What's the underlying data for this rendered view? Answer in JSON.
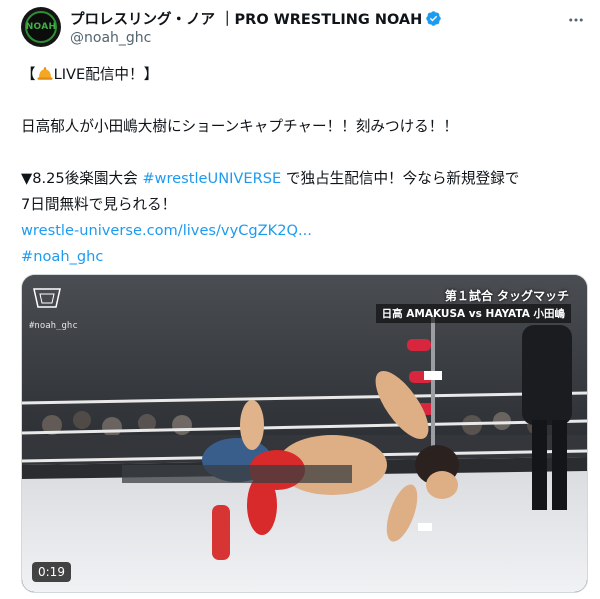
{
  "author": {
    "display_name": "プロレスリング・ノア ｜PRO WRESTLING NOAH",
    "handle": "@noah_ghc",
    "avatar_text": "NOAH"
  },
  "tweet": {
    "line1": "【 LIVE配信中！】",
    "line2": "日高郁人が小田嶋大樹にショーンキャプチャー！！刻みつける！！",
    "line3_pre": "▼8.25後楽園大会 ",
    "line3_hashtag": "#wrestleUNIVERSE",
    "line3_post": " で独占生配信中！今なら新規登録で",
    "line4": "7日間無料で見られる！",
    "link": "wrestle-universe.com/lives/vyCgZK2Q...",
    "hashtag2": "#noah_ghc"
  },
  "media": {
    "watermark": "#noah_ghc",
    "overlay_title": "第１試合 タッグマッチ",
    "overlay_match": "日高 AMAKUSA vs HAYATA 小田嶋",
    "duration": "0:19"
  },
  "colors": {
    "link": "#1d9bf0",
    "verified": "#1d9bf0",
    "text": "#0f1419",
    "muted": "#536471"
  },
  "icons": {
    "verified": "verified-badge-icon",
    "more": "more-options-icon",
    "bell": "bell-icon"
  }
}
